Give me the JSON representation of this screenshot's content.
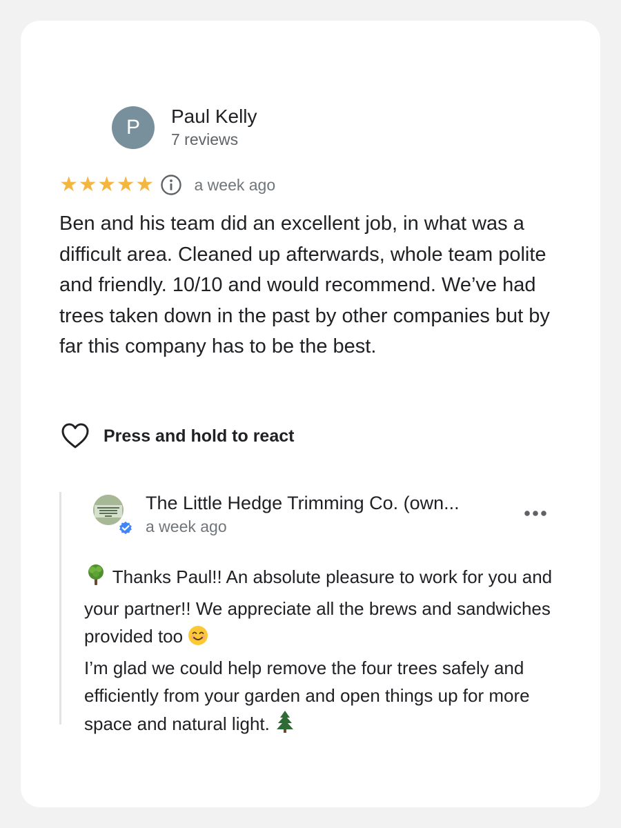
{
  "review": {
    "reviewer_initial": "P",
    "reviewer_name": "Paul Kelly",
    "reviewer_review_count": "7 reviews",
    "rating": 5,
    "max_rating": 5,
    "time": "a week ago",
    "text": "Ben and his team did an excellent job, in what was a difficult area. Cleaned up afterwards, whole team polite and friendly. 10/10 and would recommend. We’ve had trees taken down in the past by other companies but by far this company has to be the best.",
    "react_label": "Press and hold to react"
  },
  "owner_response": {
    "name": "The Little Hedge Trimming Co. (own...",
    "time": "a week ago",
    "logo_text": "THE LITTLE HEDGE TRIMMING CO.",
    "line_1": "Thanks Paul!! An absolute pleasure to work for you and your partner!! We appreciate all the brews and sandwiches provided too",
    "line_2": "I’m glad we could help remove the four trees safely and efficiently from your garden and open things up for more space and natural light."
  },
  "icons": {
    "star": "star-icon",
    "info": "info-icon",
    "heart": "heart-outline-icon",
    "verified": "verified-check-icon",
    "more": "more-horizontal-icon",
    "tree_emoji": "deciduous-tree-emoji",
    "smile_emoji": "smiling-face-emoji",
    "evergreen_emoji": "evergreen-tree-emoji"
  },
  "colors": {
    "star": "#f4b63f",
    "avatar_bg": "#78909c",
    "verified_badge": "#4285f4",
    "secondary_text": "#70757a"
  }
}
